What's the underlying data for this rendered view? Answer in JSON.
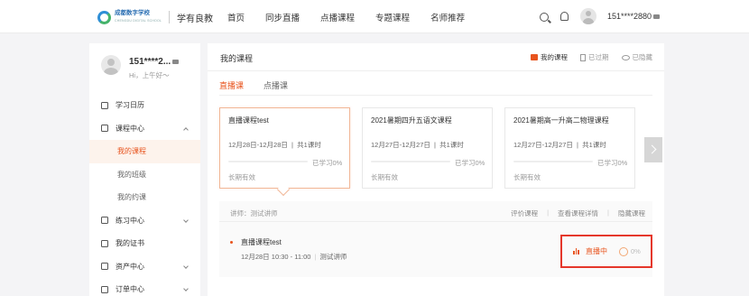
{
  "header": {
    "logo_cn": "成都数字学校",
    "logo_en": "CHENGDU DIGITAL SCHOOL",
    "brand": "学有良教",
    "nav": [
      "首页",
      "同步直播",
      "点播课程",
      "专题课程",
      "名师推荐"
    ],
    "user": "151****2880"
  },
  "profile": {
    "name": "151****2...",
    "greeting": "Hi，上午好～"
  },
  "sidebar": {
    "items": [
      {
        "label": "学习日历",
        "icon": "calendar-icon"
      },
      {
        "label": "课程中心",
        "icon": "course-icon"
      },
      {
        "label": "我的课程"
      },
      {
        "label": "我的班级"
      },
      {
        "label": "我的约课"
      },
      {
        "label": "练习中心",
        "icon": "practice-icon"
      },
      {
        "label": "我的证书",
        "icon": "certificate-icon"
      },
      {
        "label": "资产中心",
        "icon": "asset-icon"
      },
      {
        "label": "订单中心",
        "icon": "order-icon"
      }
    ]
  },
  "main": {
    "title": "我的课程",
    "filters": [
      "我的课程",
      "已过期",
      "已隐藏"
    ],
    "tabs": [
      "直播课",
      "点播课"
    ],
    "cards": [
      {
        "title": "直播课程test",
        "date": "12月28日-12月28日",
        "lessons": "共1课时",
        "progress": "已学习0%",
        "progress_value": 0,
        "validity": "长期有效"
      },
      {
        "title": "2021暑期四升五语文课程",
        "date": "12月27日-12月27日",
        "lessons": "共1课时",
        "progress": "已学习0%",
        "progress_value": 0,
        "validity": "长期有效"
      },
      {
        "title": "2021暑期高一升高二物理课程",
        "date": "12月27日-12月27日",
        "lessons": "共1课时",
        "progress": "已学习0%",
        "progress_value": 0,
        "validity": "长期有效"
      }
    ],
    "detail": {
      "teacher": "讲师：测试讲师",
      "actions": [
        "评价课程",
        "查看课程详情",
        "隐藏课程"
      ],
      "lesson_title": "直播课程test",
      "lesson_time": "12月28日 10:30 - 11:00",
      "lesson_teacher": "测试讲师",
      "status": "直播中",
      "percent": "0%"
    }
  },
  "colors": {
    "accent": "#e8541e",
    "highlight_border": "#e5372b"
  }
}
